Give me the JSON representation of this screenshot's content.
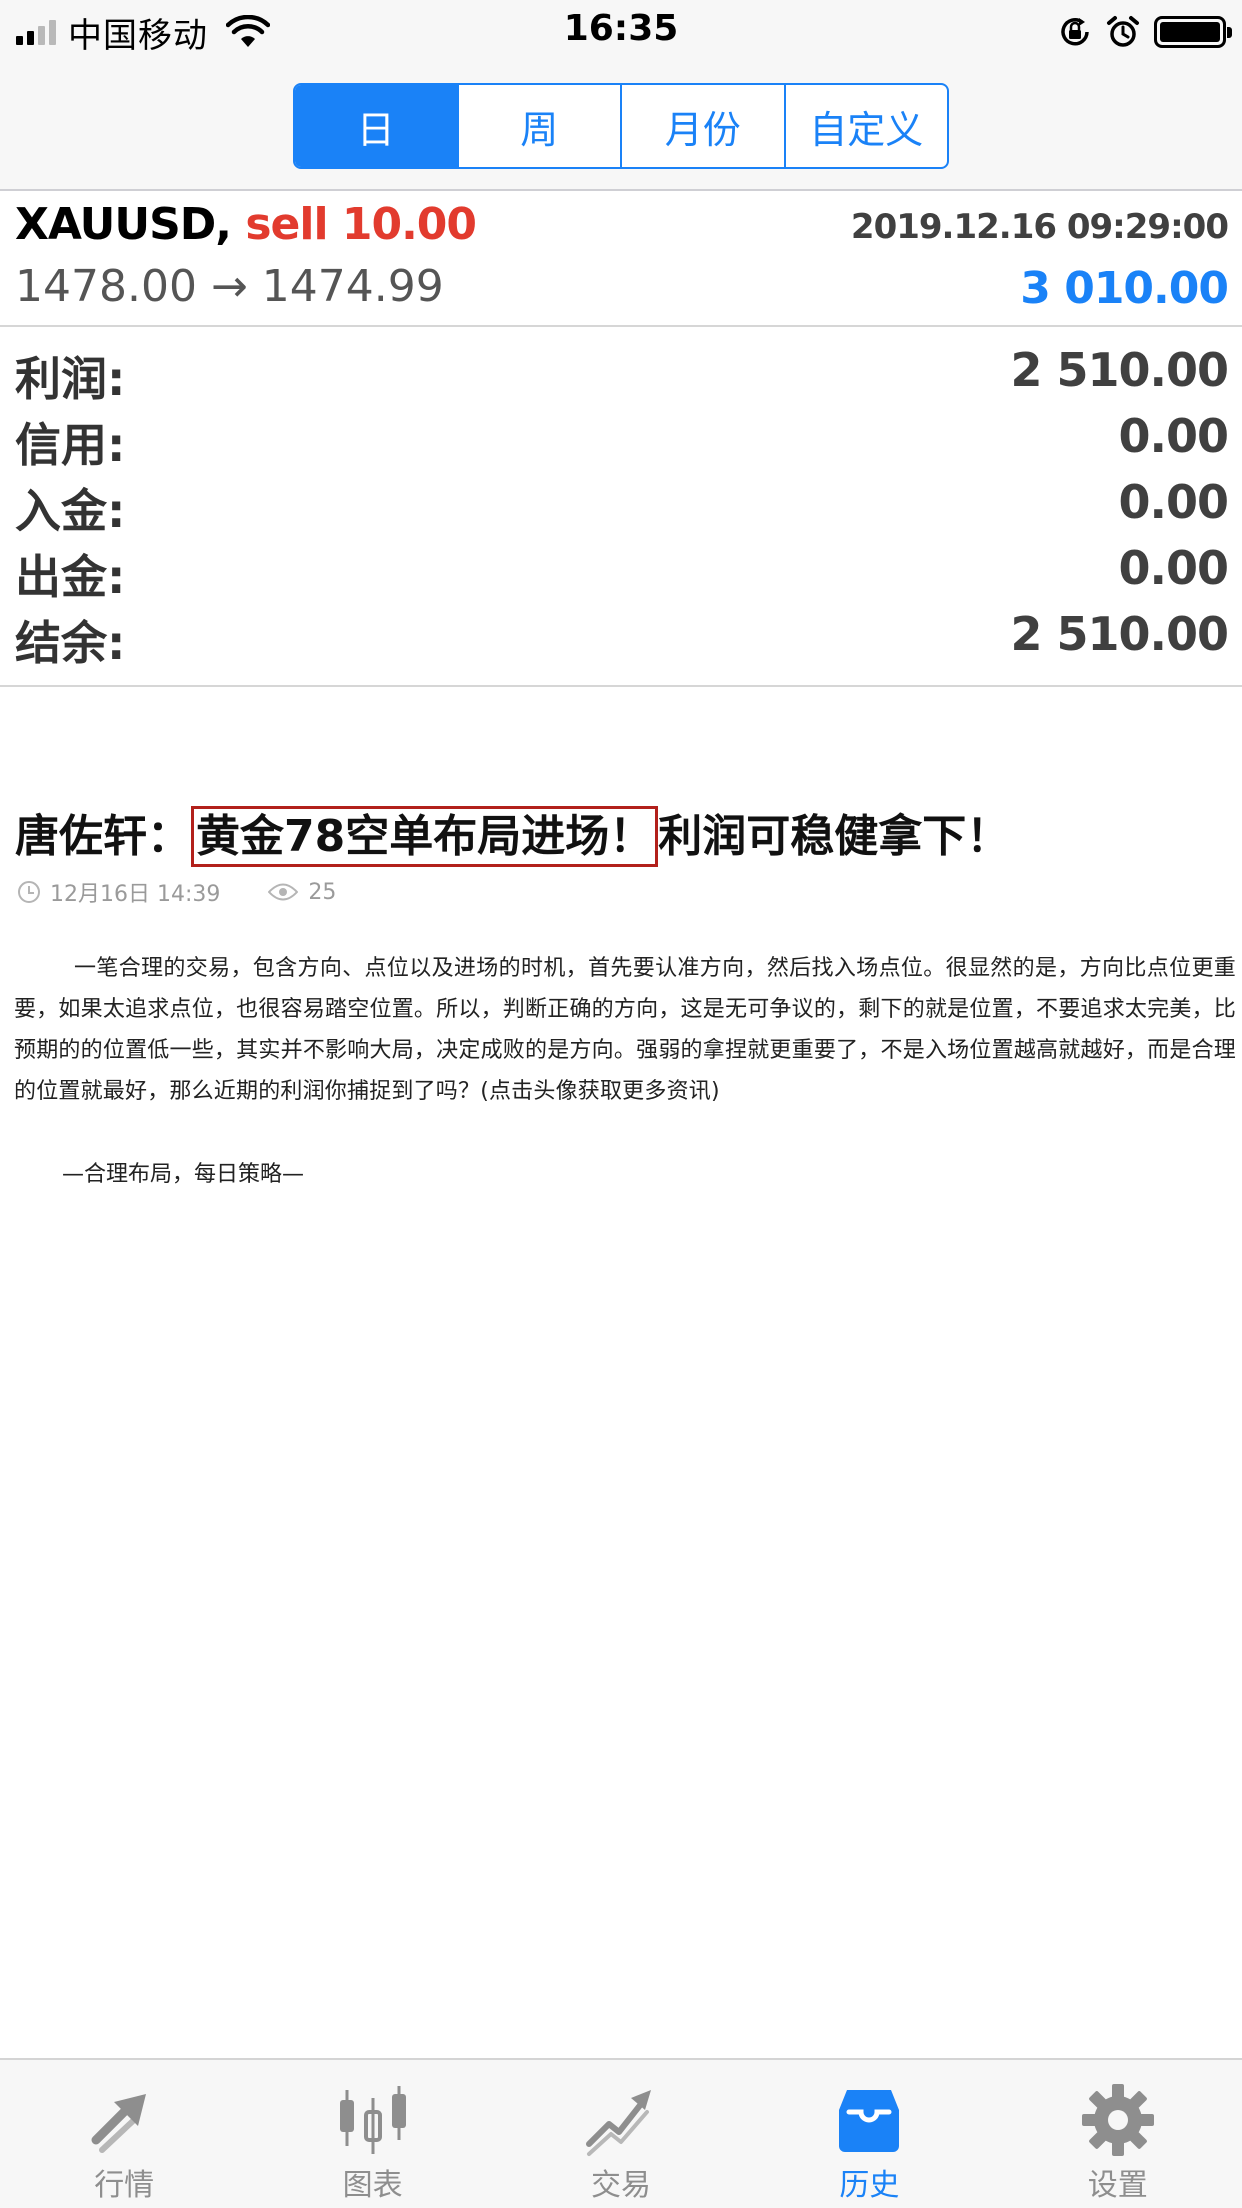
{
  "status_bar": {
    "carrier": "中国移动",
    "time": "16:35"
  },
  "segmented": {
    "items": [
      {
        "label": "日",
        "active": true
      },
      {
        "label": "周",
        "active": false
      },
      {
        "label": "月份",
        "active": false
      },
      {
        "label": "自定义",
        "active": false
      }
    ]
  },
  "trade": {
    "symbol": "XAUUSD,",
    "side": "sell 10.00",
    "datetime": "2019.12.16 09:29:00",
    "prices": "1478.00 → 1474.99",
    "profit": "3 010.00"
  },
  "summary": {
    "rows": [
      {
        "label": "利润:",
        "value": "2 510.00"
      },
      {
        "label": "信用:",
        "value": "0.00"
      },
      {
        "label": "入金:",
        "value": "0.00"
      },
      {
        "label": "出金:",
        "value": "0.00"
      },
      {
        "label": "结余:",
        "value": "2 510.00"
      }
    ]
  },
  "article": {
    "title_prefix": "唐佐轩：",
    "title_highlight": "黄金78空单布局进场！",
    "title_suffix": "利润可稳健拿下！",
    "date": "12月16日 14:39",
    "views": "25",
    "body": "一笔合理的交易，包含方向、点位以及进场的时机，首先要认准方向，然后找入场点位。很显然的是，方向比点位更重要，如果太追求点位，也很容易踏空位置。所以，判断正确的方向，这是无可争议的，剩下的就是位置，不要追求太完美，比预期的的位置低一些，其实并不影响大局，决定成败的是方向。强弱的拿捏就更重要了，不是入场位置越高就越好，而是合理的位置就最好，那么近期的利润你捕捉到了吗？(点击头像获取更多资讯)",
    "slogan": "—合理布局，每日策略—"
  },
  "tabbar": {
    "items": [
      {
        "label": "行情",
        "icon": "quotes-icon",
        "active": false
      },
      {
        "label": "图表",
        "icon": "chart-icon",
        "active": false
      },
      {
        "label": "交易",
        "icon": "trade-icon",
        "active": false
      },
      {
        "label": "历史",
        "icon": "history-icon",
        "active": true
      },
      {
        "label": "设置",
        "icon": "gear-icon",
        "active": false
      }
    ]
  },
  "colors": {
    "accent": "#1a82f7",
    "sell": "#e23b2e",
    "highlight_border": "#b2201b",
    "tab_inactive": "#8e8e8e"
  }
}
